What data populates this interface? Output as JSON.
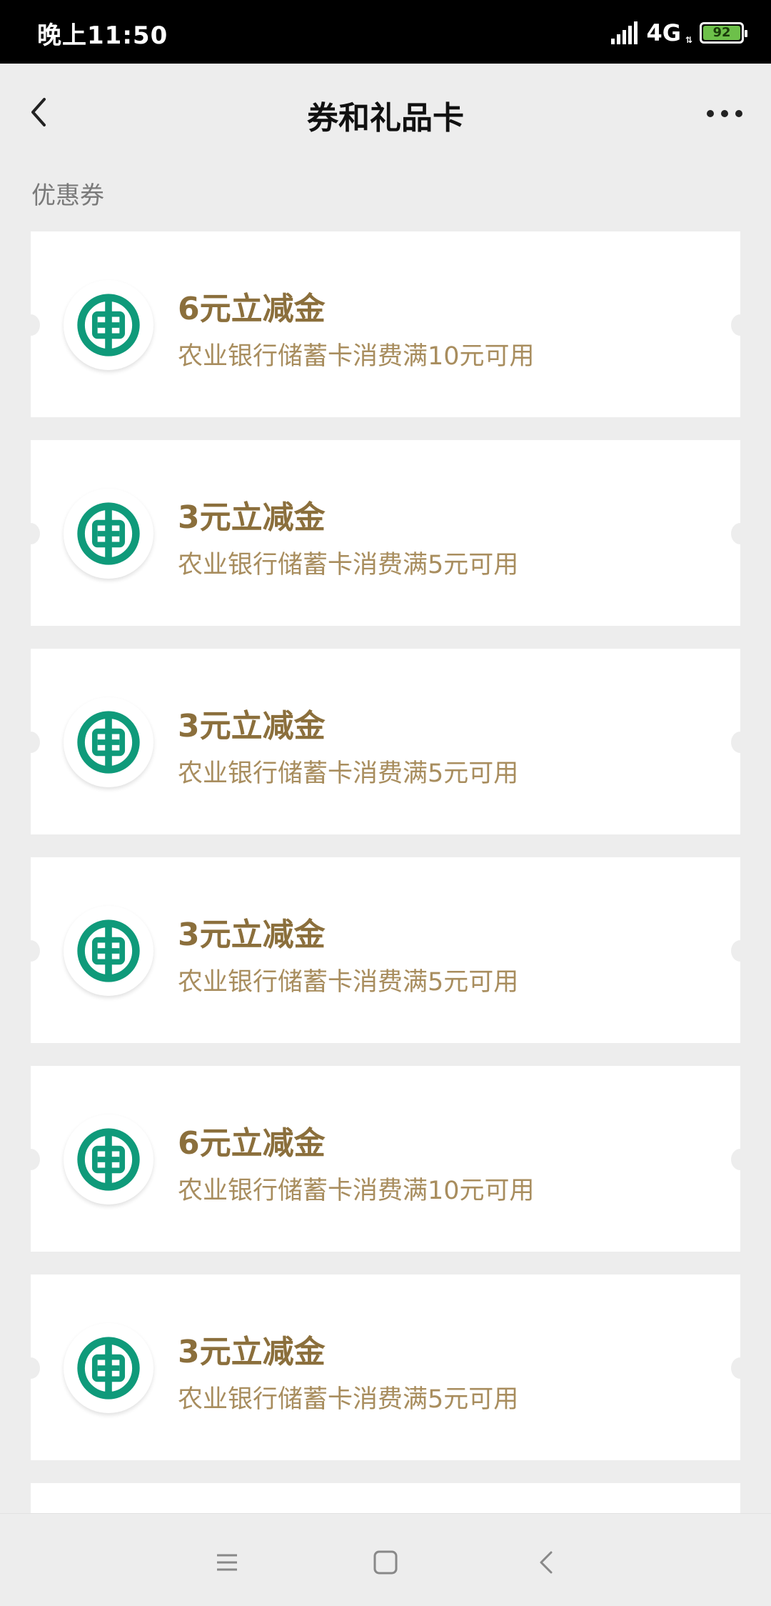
{
  "status_bar": {
    "time": "晚上11:50",
    "network": "4G",
    "network_sub": "ıl",
    "battery": "92"
  },
  "header": {
    "title": "券和礼品卡"
  },
  "section": {
    "label": "优惠券"
  },
  "coupons": [
    {
      "title": "6元立减金",
      "description": "农业银行储蓄卡消费满10元可用"
    },
    {
      "title": "3元立减金",
      "description": "农业银行储蓄卡消费满5元可用"
    },
    {
      "title": "3元立减金",
      "description": "农业银行储蓄卡消费满5元可用"
    },
    {
      "title": "3元立减金",
      "description": "农业银行储蓄卡消费满5元可用"
    },
    {
      "title": "6元立减金",
      "description": "农业银行储蓄卡消费满10元可用"
    },
    {
      "title": "3元立减金",
      "description": "农业银行储蓄卡消费满5元可用"
    }
  ],
  "icons": {
    "back": "chevron-left-icon",
    "more": "more-horizontal-icon",
    "bank_logo": "agricultural-bank-logo-icon",
    "menu": "menu-icon",
    "home": "home-square-icon",
    "nav_back": "back-triangle-icon"
  },
  "colors": {
    "coupon_title": "#8b6f3c",
    "coupon_desc": "#a88d5e",
    "bank_green": "#0f9a7a",
    "background": "#ededed"
  }
}
